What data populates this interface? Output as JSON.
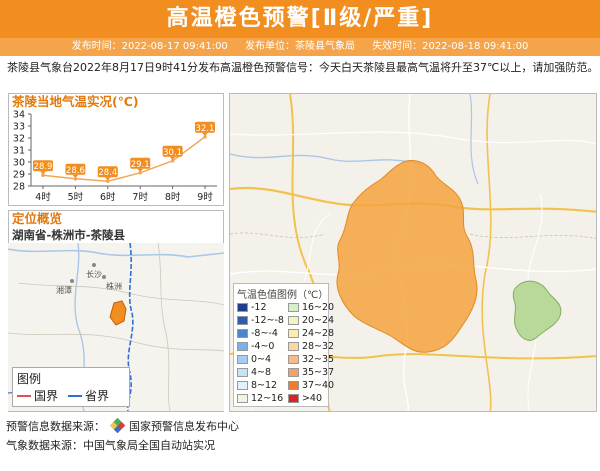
{
  "banner": {
    "title": "高温橙色预警[Ⅱ级/严重]"
  },
  "meta": {
    "publish_label": "发布时间：2022-08-17 09:41:00",
    "unit_label": "发布单位：茶陵县气象局",
    "expire_label": "失效时间：2022-08-18 09:41:00"
  },
  "intro": "茶陵县气象台2022年8月17日9时41分发布高温橙色预警信号：今天白天茶陵县最高气温将升至37℃以上，请加强防范。",
  "temp_panel": {
    "title": "茶陵当地气温实况(℃)"
  },
  "chart_data": {
    "type": "line",
    "title": "茶陵当地气温实况(℃)",
    "categories": [
      "4时",
      "5时",
      "6时",
      "7时",
      "8时",
      "9时"
    ],
    "values": [
      28.9,
      28.6,
      28.4,
      29.1,
      30.1,
      32.1
    ],
    "yticks": [
      28,
      29,
      30,
      31,
      32,
      33,
      34
    ],
    "ylim": [
      28,
      34
    ],
    "line_color": "#f4a55a",
    "label_color": "#f28d1f"
  },
  "location_panel": {
    "title": "定位概览",
    "path": "湖南省-株洲市-茶陵县",
    "cities": [
      "长沙",
      "株洲",
      "湘潭"
    ],
    "legend_title": "图例",
    "legend_items": [
      {
        "label": "国界",
        "color": "#d9534f"
      },
      {
        "label": "省界",
        "color": "#2f6fd8"
      }
    ]
  },
  "map_legend": {
    "title": "气温色值图例（℃）",
    "items": [
      {
        "label": "-12",
        "color": "#1f3d8f"
      },
      {
        "label": "16~20",
        "color": "#d8f0c8"
      },
      {
        "label": "-12~-8",
        "color": "#2c5cb0"
      },
      {
        "label": "20~24",
        "color": "#f0f4c0"
      },
      {
        "label": "-8~-4",
        "color": "#4a86d0"
      },
      {
        "label": "24~28",
        "color": "#fbecb2"
      },
      {
        "label": "-4~0",
        "color": "#7cb0e6"
      },
      {
        "label": "28~32",
        "color": "#fbd8a0"
      },
      {
        "label": "0~4",
        "color": "#a6cdf0"
      },
      {
        "label": "32~35",
        "color": "#f9b98a"
      },
      {
        "label": "4~8",
        "color": "#c6e2f6"
      },
      {
        "label": "35~37",
        "color": "#f4a06a"
      },
      {
        "label": "8~12",
        "color": "#e3f1fb"
      },
      {
        "label": "37~40",
        "color": "#f07b2a"
      },
      {
        "label": "12~16",
        "color": "#eef8e0"
      },
      {
        "label": ">40",
        "color": "#d9252a"
      }
    ]
  },
  "footer": {
    "warning_source": "预警信息数据来源：",
    "warning_source_name": "国家预警信息发布中心",
    "weather_source": "气象数据来源：中国气象局全国自动站实况"
  },
  "colors": {
    "brand": "#f28d1f",
    "brand_light": "#f6a44a",
    "warning_area": "#f5a33e"
  }
}
